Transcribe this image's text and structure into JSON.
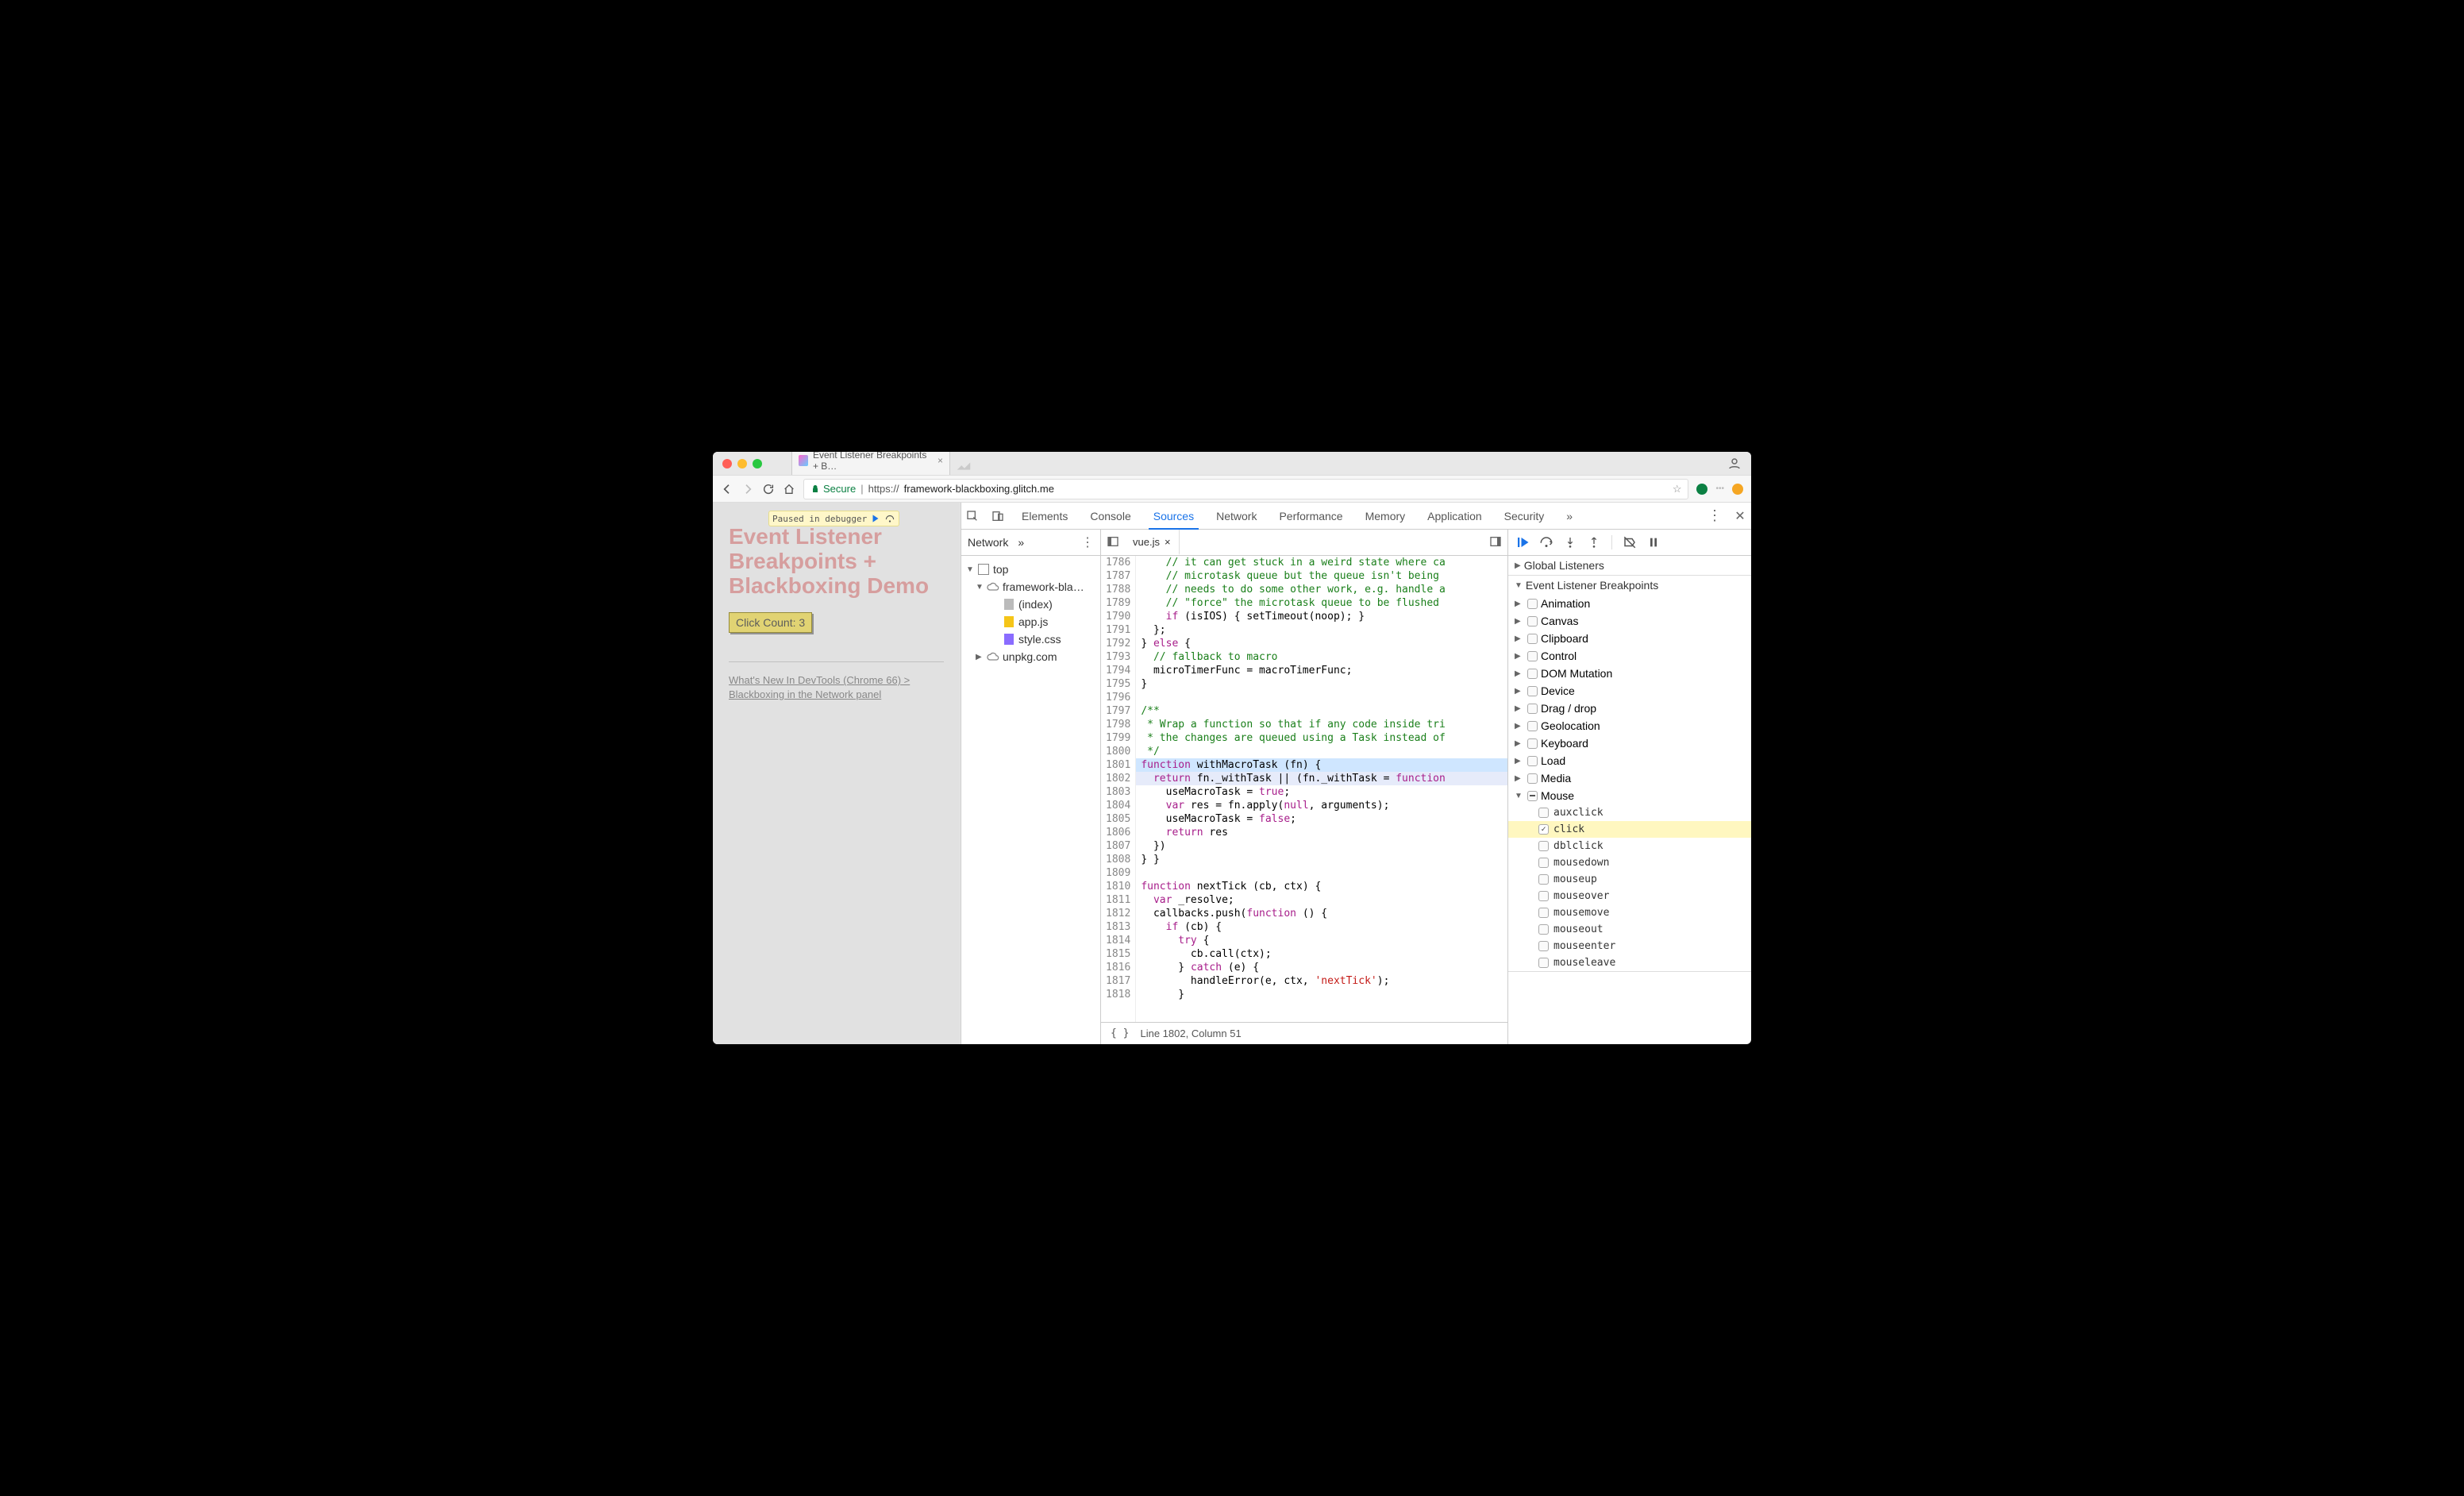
{
  "browser": {
    "tab_title": "Event Listener Breakpoints + B…",
    "secure_label": "Secure",
    "url_prefix": "https://",
    "url_host": "framework-blackboxing.glitch.me"
  },
  "page": {
    "paused_label": "Paused in debugger",
    "title_l1": "Event Listener",
    "title_l2": "Breakpoints +",
    "title_l3": "Blackboxing Demo",
    "click_btn": "Click Count: 3",
    "whatsnew": "What's New In DevTools (Chrome 66) > Blackboxing in the Network panel"
  },
  "devtools": {
    "tabs": [
      "Elements",
      "Console",
      "Sources",
      "Network",
      "Performance",
      "Memory",
      "Application",
      "Security"
    ],
    "active_tab": "Sources",
    "more": "»",
    "nav": {
      "label": "Network",
      "chev": "»",
      "tree": {
        "top": "top",
        "domain": "framework-bla…",
        "files": [
          "(index)",
          "app.js",
          "style.css"
        ],
        "ext_domain": "unpkg.com"
      }
    },
    "editor": {
      "tab": "vue.js",
      "first_line": 1786,
      "highlight_line": 1802,
      "fn_head_line": 1801,
      "status": "Line 1802, Column 51",
      "lines": [
        "    // it can get stuck in a weird state where ca",
        "    // microtask queue but the queue isn't being ",
        "    // needs to do some other work, e.g. handle a",
        "    // \"force\" the microtask queue to be flushed ",
        "    if (isIOS) { setTimeout(noop); }",
        "  };",
        "} else {",
        "  // fallback to macro",
        "  microTimerFunc = macroTimerFunc;",
        "}",
        "",
        "/**",
        " * Wrap a function so that if any code inside tri",
        " * the changes are queued using a Task instead of",
        " */",
        "function withMacroTask (fn) {",
        "  return fn._withTask || (fn._withTask = function",
        "    useMacroTask = true;",
        "    var res = fn.apply(null, arguments);",
        "    useMacroTask = false;",
        "    return res",
        "  })",
        "} }",
        "",
        "function nextTick (cb, ctx) {",
        "  var _resolve;",
        "  callbacks.push(function () {",
        "    if (cb) {",
        "      try {",
        "        cb.call(ctx);",
        "      } catch (e) {",
        "        handleError(e, ctx, 'nextTick');",
        "      }"
      ]
    },
    "debugger": {
      "global_listeners": "Global Listeners",
      "elb_title": "Event Listener Breakpoints",
      "categories": [
        "Animation",
        "Canvas",
        "Clipboard",
        "Control",
        "DOM Mutation",
        "Device",
        "Drag / drop",
        "Geolocation",
        "Keyboard",
        "Load",
        "Media"
      ],
      "mouse_label": "Mouse",
      "mouse_events": [
        "auxclick",
        "click",
        "dblclick",
        "mousedown",
        "mouseup",
        "mouseover",
        "mousemove",
        "mouseout",
        "mouseenter",
        "mouseleave"
      ],
      "checked_event": "click"
    }
  }
}
